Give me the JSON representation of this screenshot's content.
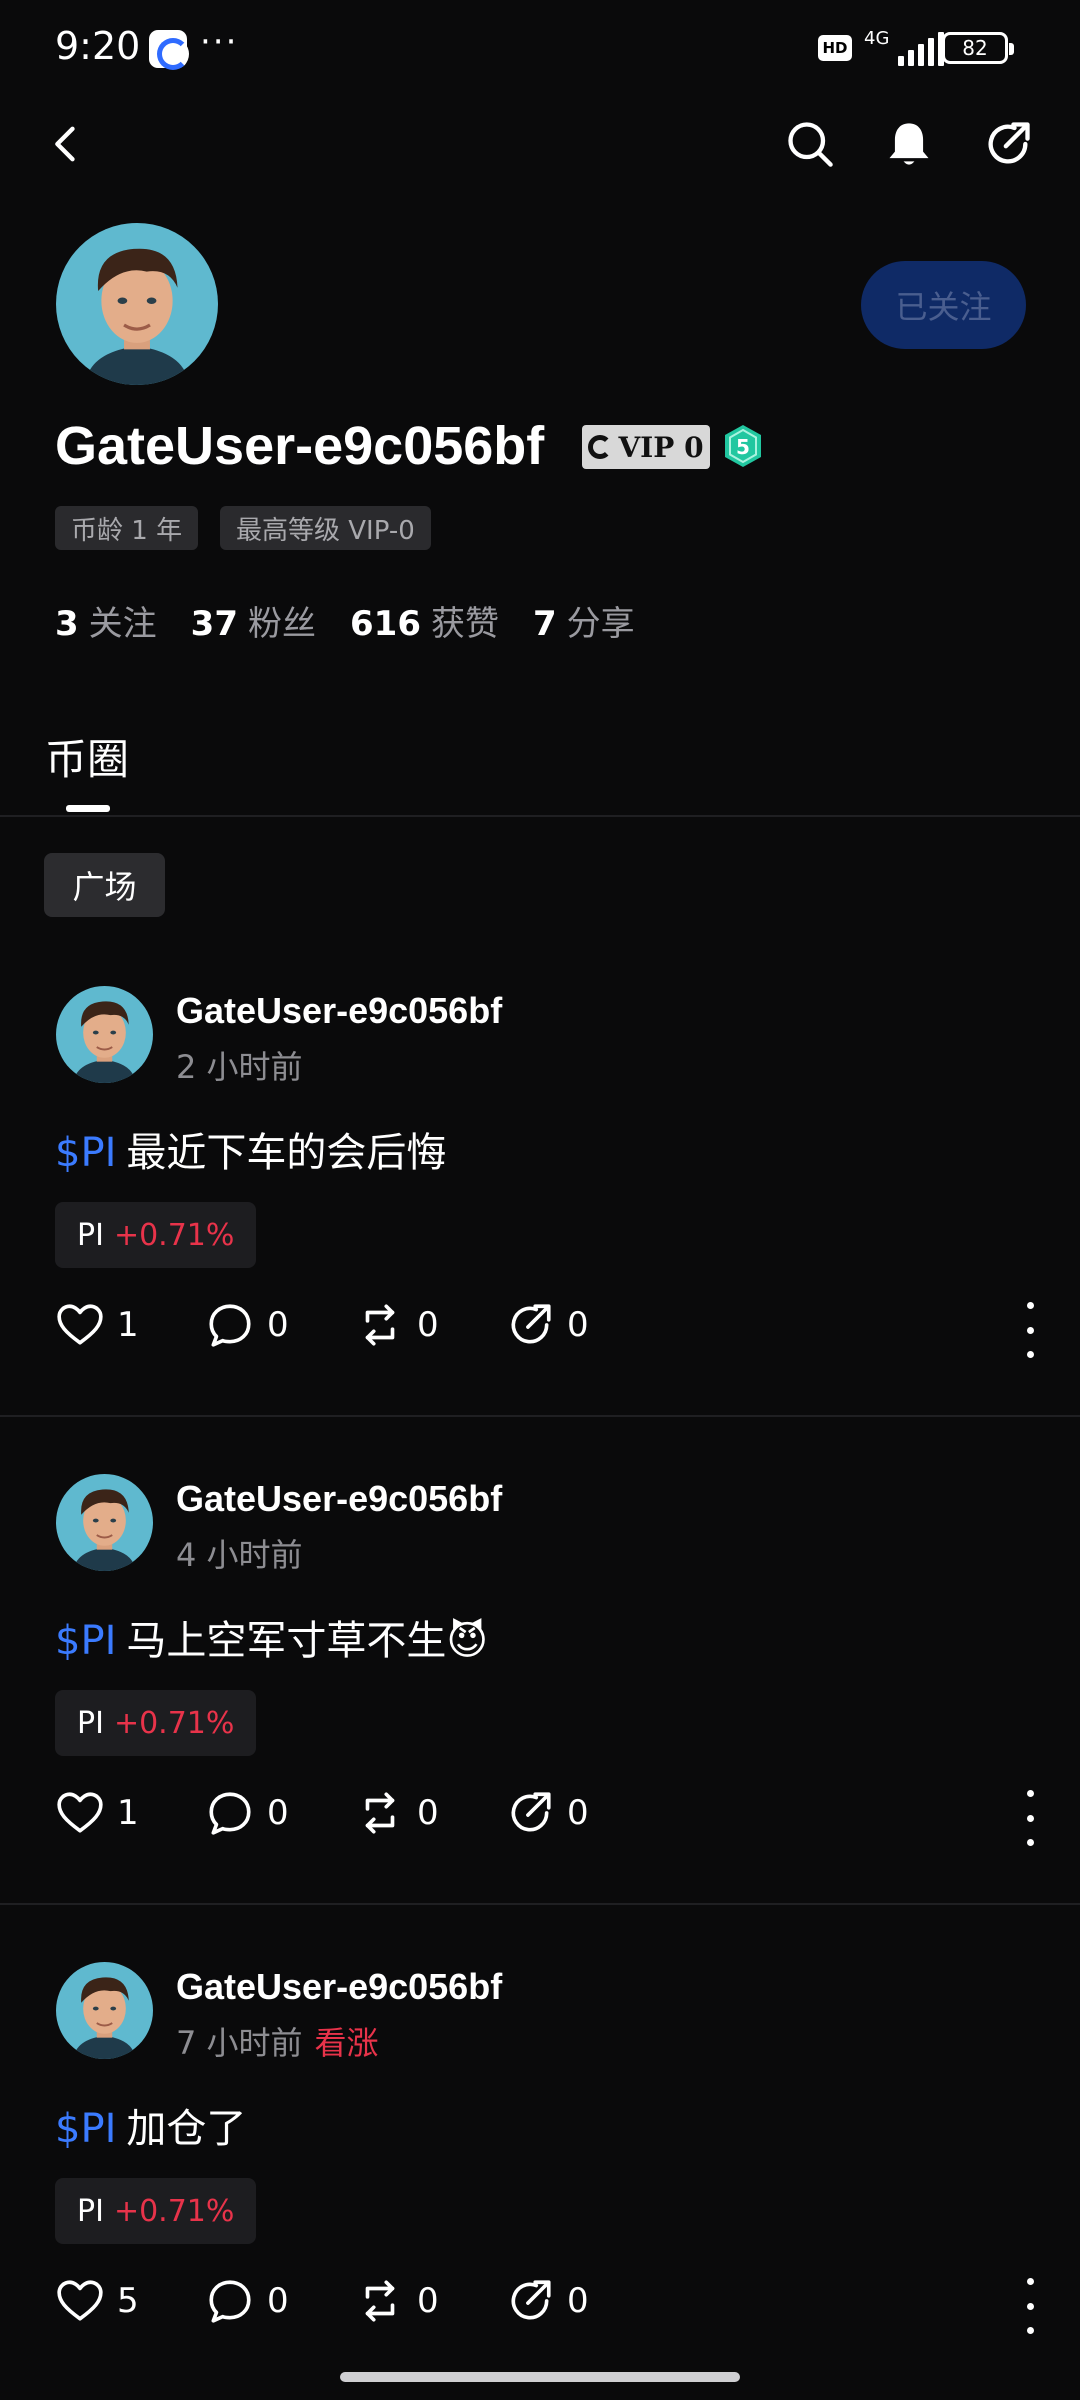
{
  "status_bar": {
    "time": "9:20",
    "more": "···",
    "hd": "HD",
    "network": "4G",
    "battery": "82"
  },
  "nav": {
    "back_icon": "chevron-left-icon",
    "search_icon": "search-icon",
    "bell_icon": "bell-icon",
    "share_icon": "share-icon"
  },
  "profile": {
    "username": "GateUser-e9c056bf",
    "vip_label": "VIP 0",
    "level": "5",
    "follow_label": "已关注",
    "tags": [
      "币龄 1 年",
      "最高等级 VIP-0"
    ],
    "stats": [
      {
        "value": "3",
        "label": "关注"
      },
      {
        "value": "37",
        "label": "粉丝"
      },
      {
        "value": "616",
        "label": "获赞"
      },
      {
        "value": "7",
        "label": "分享"
      }
    ]
  },
  "tabs": {
    "active": "币圈"
  },
  "filter_chip": "广场",
  "colors": {
    "background": "#0a0a0b",
    "accent_blue": "#3b7bff",
    "up_red": "#e8334a",
    "muted": "#8d8d92"
  },
  "posts": [
    {
      "author": "GateUser-e9c056bf",
      "time": "2 小时前",
      "sentiment": "",
      "symbol": "$PI",
      "text": "最近下车的会后悔",
      "ticker": "PI",
      "change": "+0.71%",
      "likes": "1",
      "comments": "0",
      "reposts": "0",
      "shares": "0"
    },
    {
      "author": "GateUser-e9c056bf",
      "time": "4 小时前",
      "sentiment": "",
      "symbol": "$PI",
      "text": "马上空军寸草不生😈",
      "ticker": "PI",
      "change": "+0.71%",
      "likes": "1",
      "comments": "0",
      "reposts": "0",
      "shares": "0"
    },
    {
      "author": "GateUser-e9c056bf",
      "time": "7 小时前",
      "sentiment": "看涨",
      "symbol": "$PI",
      "text": "加仓了",
      "ticker": "PI",
      "change": "+0.71%",
      "likes": "5",
      "comments": "0",
      "reposts": "0",
      "shares": "0"
    }
  ]
}
